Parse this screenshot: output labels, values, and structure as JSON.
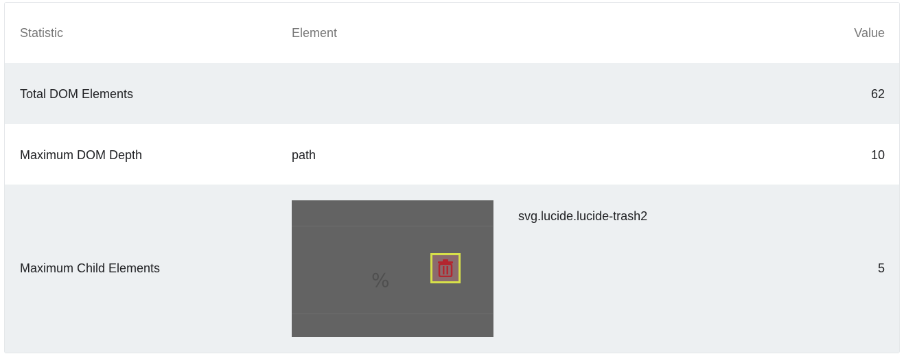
{
  "columns": {
    "statistic": "Statistic",
    "element": "Element",
    "value": "Value"
  },
  "rows": [
    {
      "statistic": "Total DOM Elements",
      "element": "",
      "value": "62"
    },
    {
      "statistic": "Maximum DOM Depth",
      "element": "path",
      "value": "10"
    },
    {
      "statistic": "Maximum Child Elements",
      "element": "svg.lucide.lucide-trash2",
      "value": "5",
      "thumbnail_text": "%",
      "thumbnail_icon": "trash-icon"
    }
  ],
  "colors": {
    "row_alt": "#edf0f2",
    "header_text": "#777777",
    "thumbnail_bg": "#636363",
    "highlight_border": "#d7e04a",
    "trash_icon": "#b3262f"
  }
}
